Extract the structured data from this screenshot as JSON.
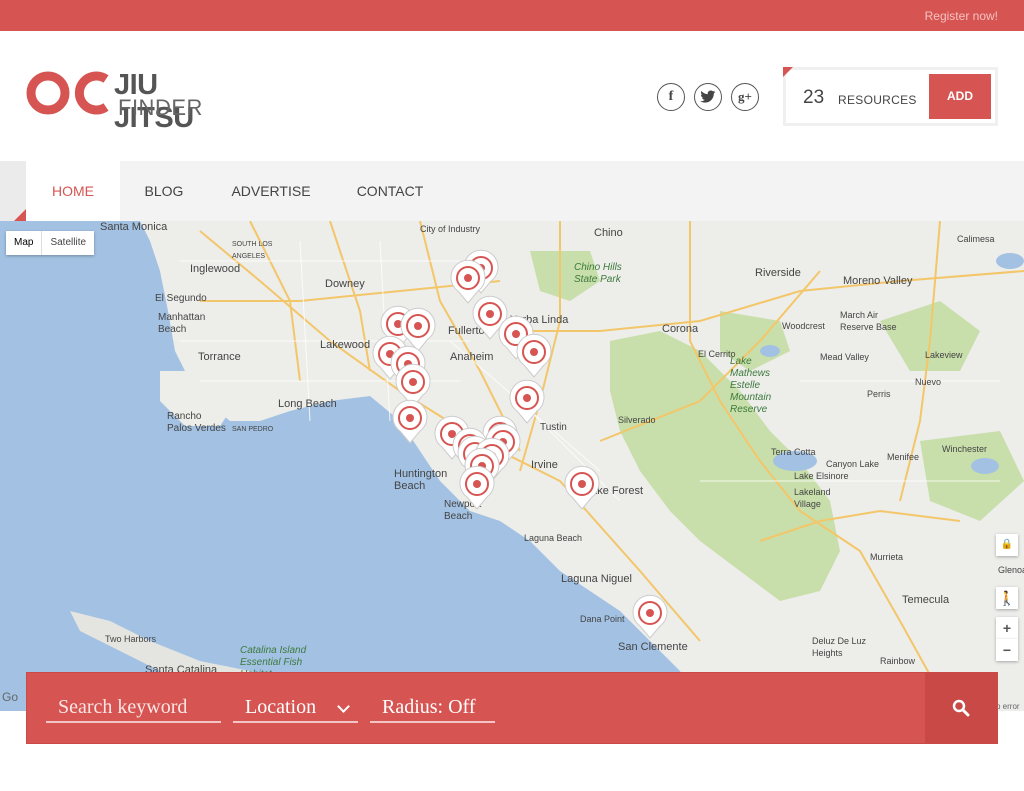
{
  "topbar": {
    "register_label": "Register now!"
  },
  "logo": {
    "mark": "OC",
    "line1": "JIU JITSU",
    "line2": "FINDER"
  },
  "social": [
    {
      "icon": "facebook-icon",
      "glyph": "f"
    },
    {
      "icon": "twitter-icon",
      "glyph": "t"
    },
    {
      "icon": "google-plus-icon",
      "glyph": "g+"
    }
  ],
  "resources": {
    "count": "23",
    "label": "RESOURCES",
    "add_label": "ADD"
  },
  "nav": {
    "items": [
      {
        "label": "HOME",
        "active": true
      },
      {
        "label": "BLOG",
        "active": false
      },
      {
        "label": "ADVERTISE",
        "active": false
      },
      {
        "label": "CONTACT",
        "active": false
      }
    ]
  },
  "map": {
    "type_map": "Map",
    "type_satellite": "Satellite",
    "zoom_in": "+",
    "zoom_out": "−",
    "labels": {
      "santa_monica": "Santa Monica",
      "south_los_angeles": "SOUTH LOS ANGELES",
      "inglewood": "Inglewood",
      "downey": "Downey",
      "el_segundo": "El Segundo",
      "manhattan_beach": "Manhattan Beach",
      "torrance": "Torrance",
      "lakewood": "Lakewood",
      "long_beach": "Long Beach",
      "rancho_palos_verdes": "Rancho Palos Verdes",
      "san_pedro": "SAN PEDRO",
      "fullerton": "Fullerton",
      "yorba_linda": "Yorba Linda",
      "anaheim": "Anaheim",
      "tustin": "Tustin",
      "irvine": "Irvine",
      "lake_forest": "Lake Forest",
      "huntington_beach": "Huntington Beach",
      "newport_beach": "Newport Beach",
      "laguna_beach": "Laguna Beach",
      "laguna_niguel": "Laguna Niguel",
      "dana_point": "Dana Point",
      "san_clemente": "San Clemente",
      "chino": "Chino",
      "chino_hills": "Chino Hills State Park",
      "corona": "Corona",
      "el_cerrito": "El Cerrito",
      "riverside": "Riverside",
      "moreno_valley": "Moreno Valley",
      "calimesa": "Calimesa",
      "woodcrest": "Woodcrest",
      "march_afb": "March Air Reserve Base",
      "mead_valley": "Mead Valley",
      "lakeview": "Lakeview",
      "lake_mathews": "Lake Mathews Estelle Mountain Reserve",
      "nuevo": "Nuevo",
      "perris": "Perris",
      "silverado": "Silverado",
      "terra_cotta": "Terra Cotta",
      "canyon_lake": "Canyon Lake",
      "lake_elsinore": "Lake Elsinore",
      "menifee": "Menifee",
      "winchester": "Winchester",
      "lakeland_village": "Lakeland Village",
      "murrieta": "Murrieta",
      "temecula": "Temecula",
      "glenoak": "Glenoa",
      "deluz": "Deluz De Luz Heights",
      "rainbow": "Rainbow",
      "two_harbors": "Two Harbors",
      "catalina_island": "Catalina Island Essential Fish Habitat",
      "santa_catalina": "Santa Catalina",
      "city_of_industry": "City of Industry",
      "google": "Go",
      "map_error": "p error"
    }
  },
  "search": {
    "keyword_placeholder": "Search keyword",
    "location_label": "Location",
    "radius_label": "Radius: Off"
  },
  "colors": {
    "accent": "#d65552",
    "ocean": "#a3c2e3",
    "land": "#ededea",
    "park": "#c8dfab"
  }
}
